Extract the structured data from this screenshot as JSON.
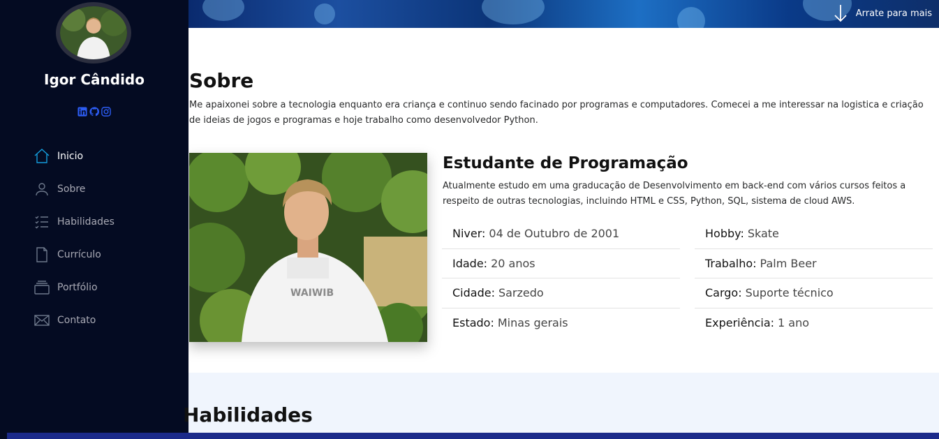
{
  "profile": {
    "name": "Igor Cândido",
    "socials": [
      "linkedin-icon",
      "github-icon",
      "instagram-icon"
    ]
  },
  "nav": {
    "items": [
      {
        "label": "Inicio",
        "icon": "home-icon",
        "active": true
      },
      {
        "label": "Sobre",
        "icon": "person-icon",
        "active": false
      },
      {
        "label": "Habilidades",
        "icon": "list-icon",
        "active": false
      },
      {
        "label": "Currículo",
        "icon": "file-icon",
        "active": false
      },
      {
        "label": "Portfólio",
        "icon": "collection-icon",
        "active": false
      },
      {
        "label": "Contato",
        "icon": "envelope-icon",
        "active": false
      }
    ]
  },
  "banner": {
    "scroll_hint": "Arrate para mais"
  },
  "about": {
    "title": "Sobre",
    "text": "Me apaixonei sobre a tecnologia enquanto era criança e continuo sendo facinado por programas e computadores. Comecei a me interessar na logistica e criação de ideias de jogos e programas e hoje trabalho como desenvolvedor Python.",
    "subtitle": "Estudante de Programação",
    "subtext": "Atualmente estudo em uma graducação de Desenvolvimento em back-end com vários cursos feitos a respeito de outras tecnologias, incluindo HTML e CSS, Python, SQL, sistema de cloud AWS.",
    "info_left": [
      {
        "key": "Niver:",
        "value": "04 de Outubro de 2001"
      },
      {
        "key": "Idade:",
        "value": "20 anos"
      },
      {
        "key": "Cidade:",
        "value": "Sarzedo"
      },
      {
        "key": "Estado:",
        "value": "Minas gerais"
      }
    ],
    "info_right": [
      {
        "key": "Hobby:",
        "value": "Skate"
      },
      {
        "key": "Trabalho:",
        "value": "Palm Beer"
      },
      {
        "key": "Cargo:",
        "value": "Suporte técnico"
      },
      {
        "key": "Experiência:",
        "value": "1 ano"
      }
    ]
  },
  "skills": {
    "title": "Habilidades"
  },
  "colors": {
    "sidebar_bg": "#040b22",
    "accent": "#149ddd",
    "social": "#2c5cf2",
    "skills_bg": "#f0f5fd",
    "bottom_bar": "#1b2a8a"
  }
}
